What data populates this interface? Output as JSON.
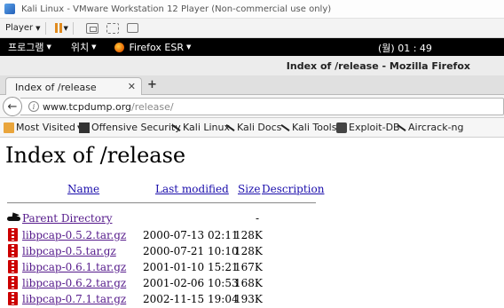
{
  "vmware": {
    "window_title": "Kali Linux - VMware Workstation 12 Player (Non-commercial use only)",
    "player_menu": "Player"
  },
  "kali_panel": {
    "applications": "프로그램",
    "places": "위치",
    "active_app": "Firefox ESR",
    "clock": "(월) 01 : 49"
  },
  "firefox": {
    "window_title": "Index of /release - Mozilla Firefox",
    "tab_label": "Index of /release",
    "url_host": "www.tcpdump.org",
    "url_path": "/release/",
    "bookmarks": [
      {
        "label": "Most Visited",
        "icon": "folder-icon",
        "has_menu": true
      },
      {
        "label": "Offensive Security",
        "icon": "offsec-icon"
      },
      {
        "label": "Kali Linux",
        "icon": "kali-dragon-icon"
      },
      {
        "label": "Kali Docs",
        "icon": "kali-dragon-icon"
      },
      {
        "label": "Kali Tools",
        "icon": "kali-dragon-icon"
      },
      {
        "label": "Exploit-DB",
        "icon": "exploit-db-icon"
      },
      {
        "label": "Aircrack-ng",
        "icon": "aircrack-icon"
      }
    ]
  },
  "listing": {
    "heading": "Index of /release",
    "columns": {
      "name": "Name",
      "last_modified": "Last modified",
      "size": "Size",
      "description": "Description"
    },
    "parent": {
      "name": "Parent Directory",
      "size": "-"
    },
    "files": [
      {
        "name": "libpcap-0.5.2.tar.gz",
        "modified": "2000-07-13 02:11",
        "size": "128K"
      },
      {
        "name": "libpcap-0.5.tar.gz",
        "modified": "2000-07-21 10:10",
        "size": "128K"
      },
      {
        "name": "libpcap-0.6.1.tar.gz",
        "modified": "2001-01-10 15:21",
        "size": "167K"
      },
      {
        "name": "libpcap-0.6.2.tar.gz",
        "modified": "2001-02-06 10:53",
        "size": "168K"
      },
      {
        "name": "libpcap-0.7.1.tar.gz",
        "modified": "2002-11-15 19:04",
        "size": "193K"
      }
    ]
  },
  "colors": {
    "link_unvisited": "#1a0dab",
    "link_visited": "#551a8b",
    "kali_panel_bg": "#000000",
    "pause_accent": "#e08a1e"
  }
}
